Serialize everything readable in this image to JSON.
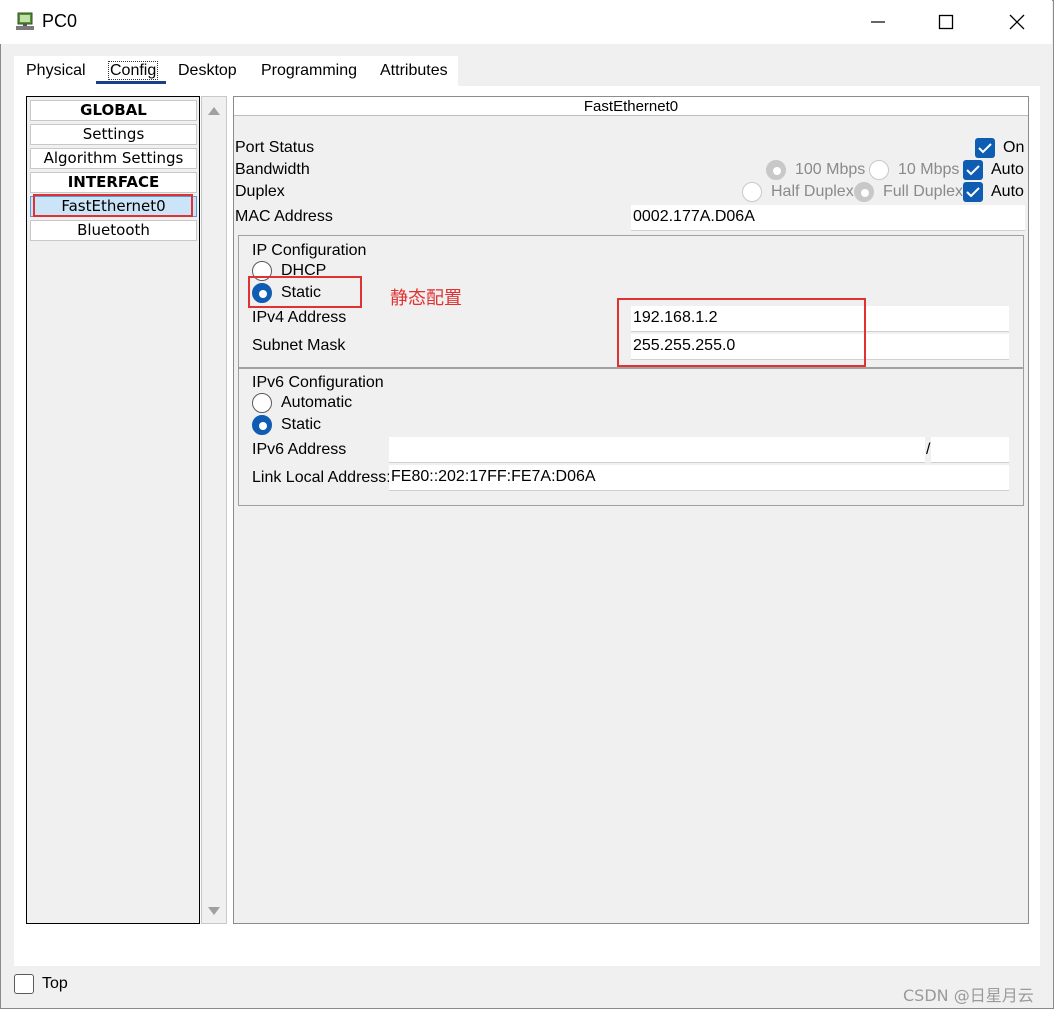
{
  "window": {
    "title": "PC0",
    "icon": "pc-icon",
    "controls": {
      "minimize": "minimize-icon",
      "maximize": "maximize-icon",
      "close": "close-icon"
    }
  },
  "tabs": [
    {
      "label": "Physical"
    },
    {
      "label": "Config",
      "selected": true
    },
    {
      "label": "Desktop"
    },
    {
      "label": "Programming"
    },
    {
      "label": "Attributes"
    }
  ],
  "sidebar": {
    "items": [
      {
        "label": "GLOBAL",
        "header": true
      },
      {
        "label": "Settings"
      },
      {
        "label": "Algorithm Settings"
      },
      {
        "label": "INTERFACE",
        "header": true
      },
      {
        "label": "FastEthernet0",
        "selected": true
      },
      {
        "label": "Bluetooth"
      }
    ]
  },
  "interface": {
    "title": "FastEthernet0",
    "port_status": {
      "label": "Port Status",
      "on_label": "On",
      "on_checked": true
    },
    "bandwidth": {
      "label": "Bandwidth",
      "opt_100": "100 Mbps",
      "opt_10": "10 Mbps",
      "auto_label": "Auto",
      "auto_checked": true
    },
    "duplex": {
      "label": "Duplex",
      "opt_half": "Half Duplex",
      "opt_full": "Full Duplex",
      "auto_label": "Auto",
      "auto_checked": true
    },
    "mac": {
      "label": "MAC Address",
      "value": "0002.177A.D06A"
    }
  },
  "ip_config": {
    "title": "IP Configuration",
    "dhcp_label": "DHCP",
    "static_label": "Static",
    "mode": "Static",
    "ipv4_label": "IPv4 Address",
    "ipv4_value": "192.168.1.2",
    "mask_label": "Subnet Mask",
    "mask_value": "255.255.255.0"
  },
  "ipv6_config": {
    "title": "IPv6 Configuration",
    "automatic_label": "Automatic",
    "static_label": "Static",
    "mode": "Static",
    "address_label": "IPv6 Address",
    "address_value": "",
    "prefix_sep": "/",
    "prefix_value": "",
    "link_local_label": "Link Local Address:",
    "link_local_value": "FE80::202:17FF:FE7A:D06A"
  },
  "footer": {
    "top_label": "Top",
    "top_checked": false
  },
  "annotation": {
    "text": "静态配置",
    "color": "#e03232"
  },
  "watermark": "CSDN @日星月云",
  "colors": {
    "accent": "#0f5cb3",
    "selection": "#cce4f7",
    "annotation": "#e03232"
  }
}
